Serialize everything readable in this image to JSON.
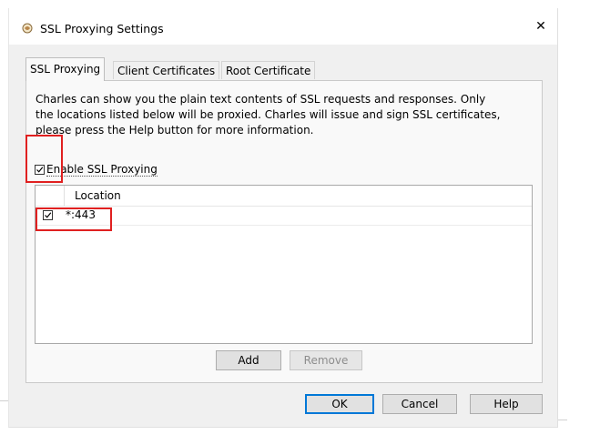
{
  "window": {
    "title": "SSL Proxying Settings",
    "close_glyph": "✕",
    "icon": "charles-app-icon"
  },
  "tabs": [
    {
      "label": "SSL Proxying",
      "active": true
    },
    {
      "label": "Client Certificates",
      "active": false
    },
    {
      "label": "Root Certificate",
      "active": false
    }
  ],
  "panel": {
    "description_lines": [
      "Charles can show you the plain text contents of SSL requests and responses. Only",
      "the locations listed below will be proxied. Charles will issue and sign SSL certificates,",
      "please press the Help button for more information."
    ],
    "enable": {
      "label": "Enable SSL Proxying",
      "checked": true
    },
    "table": {
      "columns": [
        "",
        "Location"
      ],
      "rows": [
        {
          "enabled": true,
          "location": "*:443"
        }
      ]
    },
    "add_label": "Add",
    "remove_label": "Remove"
  },
  "footer": {
    "ok_label": "OK",
    "cancel_label": "Cancel",
    "help_label": "Help"
  },
  "colors": {
    "highlight": "#e02020",
    "dialog_bg": "#f0f0f0",
    "focus_border": "#0078d7"
  }
}
